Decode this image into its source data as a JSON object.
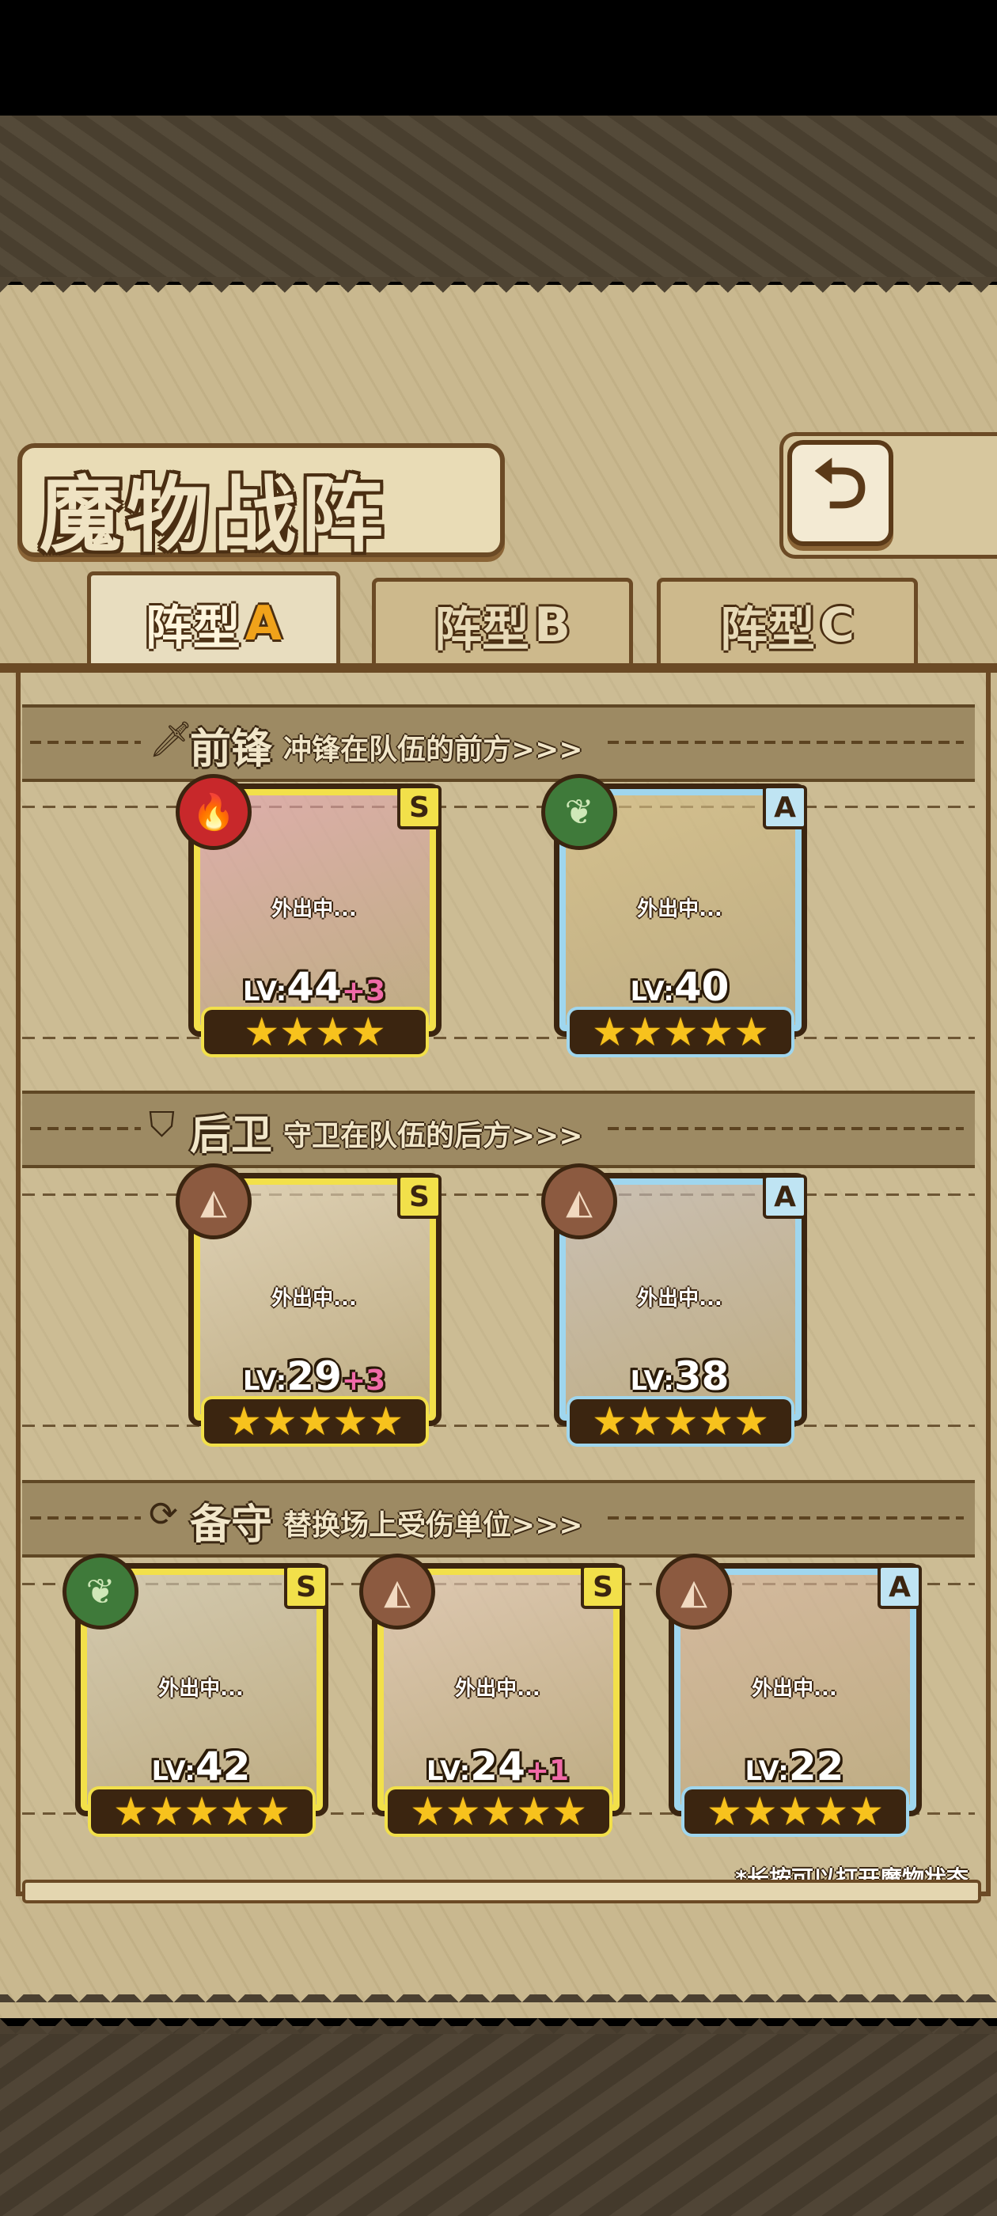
{
  "title": "魔物战阵",
  "back_icon": "back-arrow-icon",
  "tabs": [
    {
      "label": "阵型",
      "letter": "A",
      "active": true
    },
    {
      "label": "阵型",
      "letter": "B",
      "active": false
    },
    {
      "label": "阵型",
      "letter": "C",
      "active": false
    }
  ],
  "sections": {
    "front": {
      "icon": "sword-icon",
      "title": "前锋",
      "desc": "冲锋在队伍的前方>>>"
    },
    "back": {
      "icon": "shield-icon",
      "title": "后卫",
      "desc": "守卫在队伍的后方>>>"
    },
    "reserve": {
      "icon": "swap-icon",
      "title": "备守",
      "desc": "替换场上受伤单位>>>"
    }
  },
  "status_text": "外出中...",
  "lv_prefix": "LV:",
  "cards": [
    {
      "rank": "S",
      "element": "fire",
      "level": "44",
      "plus": "+3",
      "stars": "★★★★",
      "portrait_color": "#e8a6b8"
    },
    {
      "rank": "A",
      "element": "grass",
      "level": "40",
      "plus": "",
      "stars": "★★★★★",
      "portrait_color": "#d9c38a"
    },
    {
      "rank": "S",
      "element": "earth",
      "level": "29",
      "plus": "+3",
      "stars": "★★★★★",
      "portrait_color": "#e9ddc8"
    },
    {
      "rank": "A",
      "element": "earth",
      "level": "38",
      "plus": "",
      "stars": "★★★★★",
      "portrait_color": "#c9c2c6"
    },
    {
      "rank": "S",
      "element": "grass",
      "level": "42",
      "plus": "",
      "stars": "★★★★★",
      "portrait_color": "#d8d2c0"
    },
    {
      "rank": "S",
      "element": "earth",
      "level": "24",
      "plus": "+1",
      "stars": "★★★★★",
      "portrait_color": "#e8cfc2"
    },
    {
      "rank": "A",
      "element": "earth",
      "level": "22",
      "plus": "",
      "stars": "★★★★★",
      "portrait_color": "#d9b8a4"
    }
  ],
  "note": "*长按可以打开魔物状态"
}
